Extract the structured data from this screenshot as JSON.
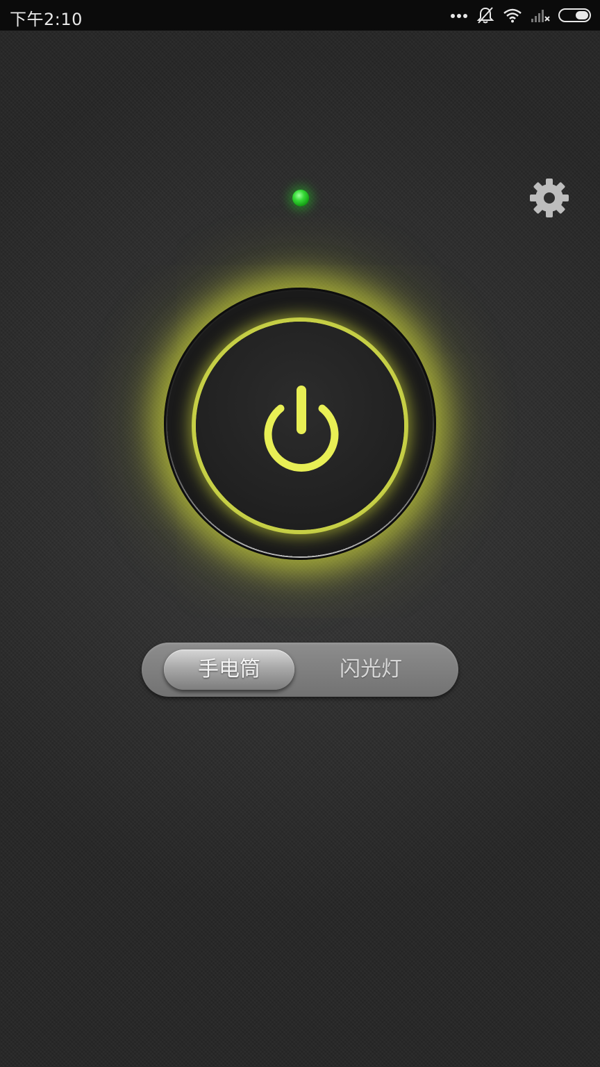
{
  "status_bar": {
    "time": "下午2:10",
    "icons": [
      "more-dots-icon",
      "mute-bell-icon",
      "wifi-icon",
      "no-signal-icon",
      "battery-icon"
    ]
  },
  "indicator": {
    "state": "on",
    "color": "#33d433"
  },
  "power": {
    "state": "on",
    "glow_color": "#e6ee50"
  },
  "mode_switch": {
    "options": [
      {
        "label": "手电筒",
        "selected": true
      },
      {
        "label": "闪光灯",
        "selected": false
      }
    ]
  },
  "colors": {
    "accent": "#e6ee50",
    "background": "#2e2e2e"
  }
}
